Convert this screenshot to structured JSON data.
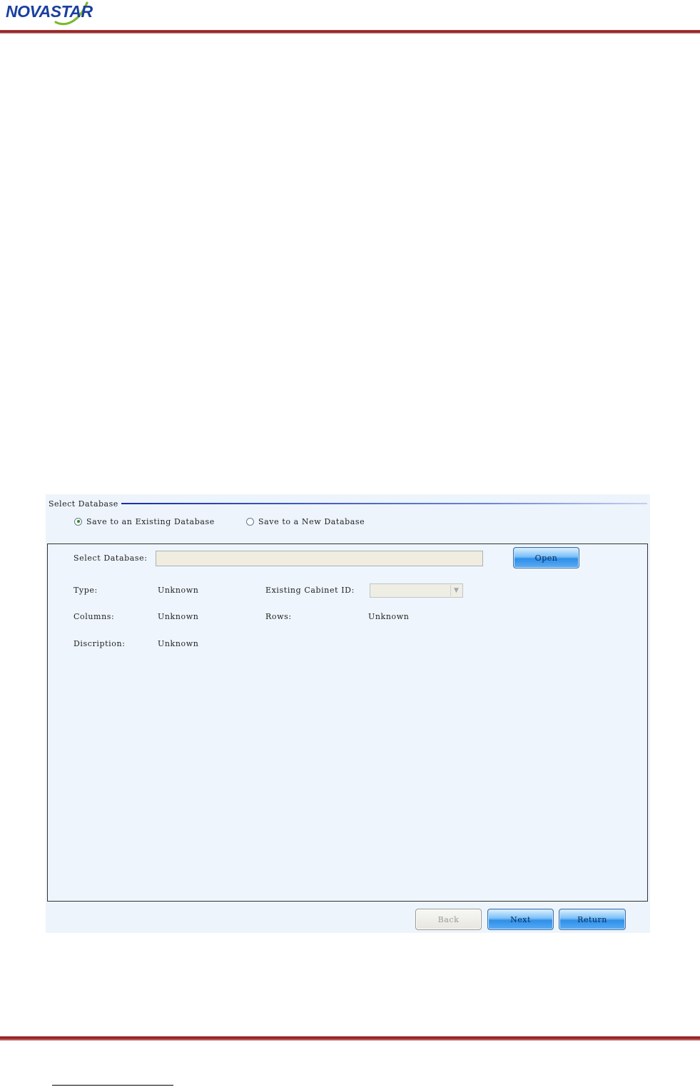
{
  "header": {
    "logo_text": "NOVASTAR"
  },
  "dialog": {
    "group_title": "Select Database",
    "radio_existing": {
      "label": "Save to an Existing Database",
      "checked": true
    },
    "radio_new": {
      "label": "Save to a New Database",
      "checked": false
    },
    "select_db_label": "Select Database:",
    "select_db_value": "",
    "open_button": "Open",
    "fields": {
      "type_label": "Type:",
      "type_value": "Unknown",
      "cabinet_id_label": "Existing Cabinet ID:",
      "cabinet_id_value": "",
      "columns_label": "Columns:",
      "columns_value": "Unknown",
      "rows_label": "Rows:",
      "rows_value": "Unknown",
      "description_label": "Discription:",
      "description_value": "Unknown"
    },
    "buttons": {
      "back": "Back",
      "next": "Next",
      "return": "Return"
    }
  },
  "colors": {
    "brand_blue": "#1b3fa0",
    "brand_green": "#7ab92a",
    "rule_red": "#8a1c1c",
    "dialog_bg": "#edf4fb"
  }
}
